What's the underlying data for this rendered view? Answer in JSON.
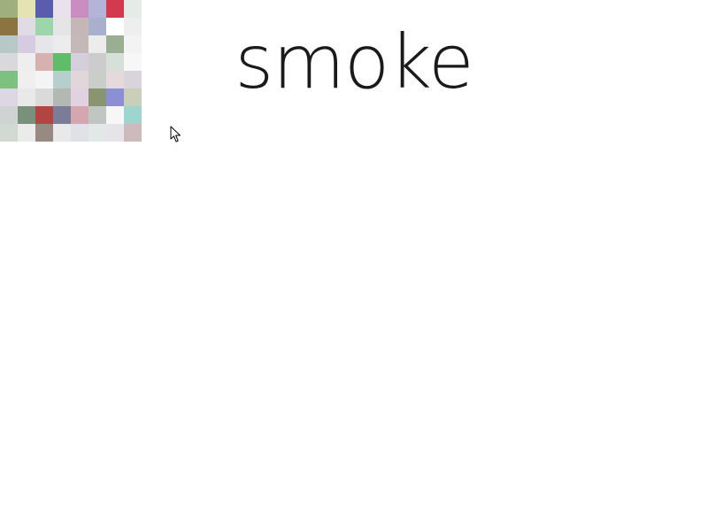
{
  "title": "smoke",
  "mosaic": {
    "colors": [
      [
        "#9fb07e",
        "#e3e3b4",
        "#5a5cad",
        "#e9e2ec",
        "#c98dc2",
        "#b3b4d8",
        "#d23a4e",
        "#e5ebe7"
      ],
      [
        "#8b7442",
        "#e1dbe5",
        "#9dd5ad",
        "#e5e5e5",
        "#c5b7b8",
        "#a9b0ce",
        "#ffffff",
        "#eeeeee"
      ],
      [
        "#b7c9c6",
        "#d7cbe2",
        "#e5e5ea",
        "#ececef",
        "#c5b8b8",
        "#ececec",
        "#99ae93",
        "#f3f3f3"
      ],
      [
        "#d9d9dc",
        "#eeeeee",
        "#d6b1b2",
        "#5fbd6a",
        "#d5cedb",
        "#cccccc",
        "#d6dfd9",
        "#f7f7f7"
      ],
      [
        "#7cc17f",
        "#efefef",
        "#f4f4f4",
        "#b6cfcc",
        "#e1d7da",
        "#c9cfc8",
        "#e5d9dc",
        "#d9d3dc"
      ],
      [
        "#dcd7e2",
        "#e9e9e9",
        "#dadada",
        "#b3b8b2",
        "#e2d1e0",
        "#889570",
        "#8c8fd6",
        "#cacfb9"
      ],
      [
        "#cfd3d3",
        "#79917a",
        "#b24544",
        "#7b7c97",
        "#d3a6b0",
        "#c2c6c3",
        "#f7f7f7",
        "#9ed6cf"
      ],
      [
        "#d2d9d2",
        "#ebebeb",
        "#968a83",
        "#e9e9e9",
        "#dfe1e6",
        "#e2e7e8",
        "#e5e4e8",
        "#ccbabc"
      ]
    ]
  },
  "cursor": {
    "icon": "arrow-pointer-icon"
  }
}
